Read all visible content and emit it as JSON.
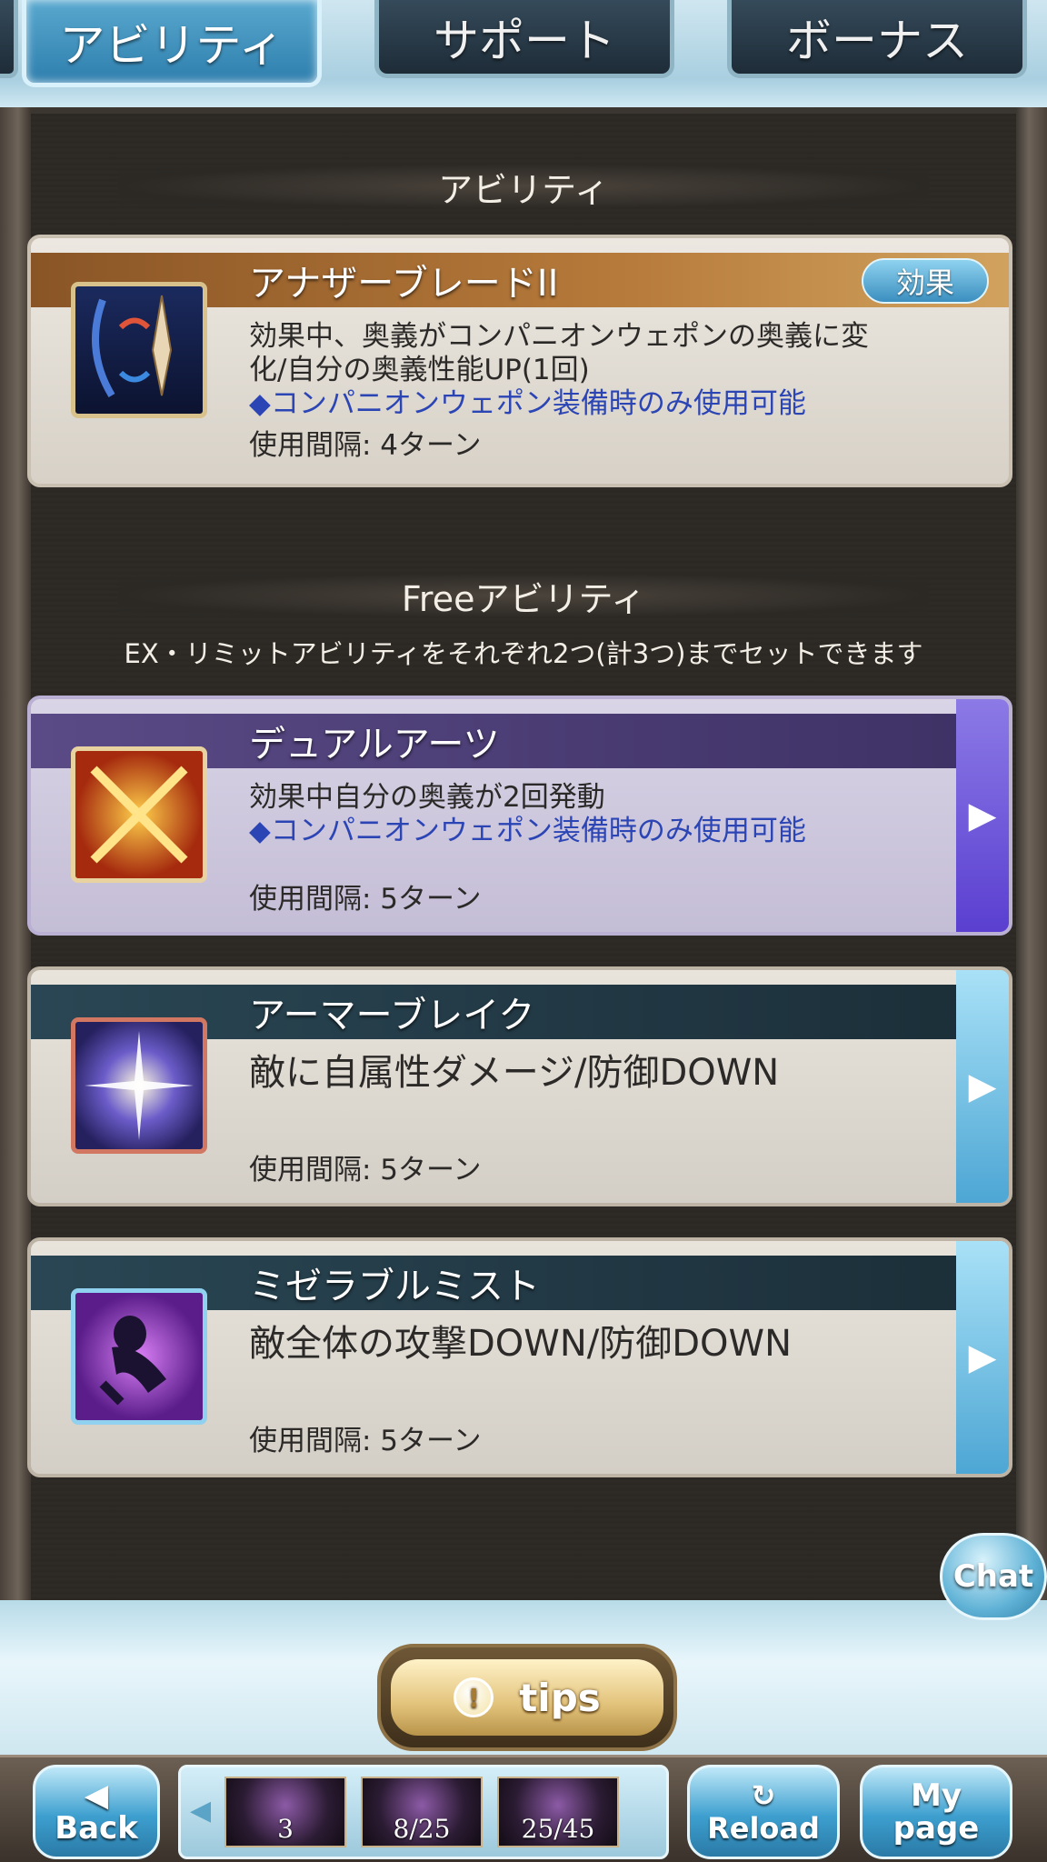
{
  "tabs": {
    "ability": "アビリティ",
    "support": "サポート",
    "bonus": "ボーナス"
  },
  "sections": {
    "ability_title": "アビリティ",
    "free_title": "Freeアビリティ",
    "free_note": "EX・リミットアビリティをそれぞれ2つ(計3つ)までセットできます"
  },
  "abilities": {
    "main": {
      "name": "アナザーブレードII",
      "effect_badge": "効果",
      "desc_line1": "効果中、奥義がコンパニオンウェポンの奥義に変",
      "desc_line2": "化/自分の奥義性能UP(1回)",
      "desc_note": "◆コンパニオンウェポン装備時のみ使用可能",
      "cooldown": "使用間隔: 4ターン"
    },
    "dual": {
      "name": "デュアルアーツ",
      "desc_line1": "効果中自分の奥義が2回発動",
      "desc_note": "◆コンパニオンウェポン装備時のみ使用可能",
      "cooldown": "使用間隔: 5ターン"
    },
    "armor": {
      "name": "アーマーブレイク",
      "desc_line1": "敵に自属性ダメージ/防御DOWN",
      "cooldown": "使用間隔: 5ターン"
    },
    "mist": {
      "name": "ミゼラブルミスト",
      "desc_line1": "敵全体の攻撃DOWN/防御DOWN",
      "cooldown": "使用間隔: 5ターン"
    }
  },
  "chat": {
    "label": "Chat"
  },
  "tips": {
    "label": "tips"
  },
  "nav": {
    "back_line1": "◀",
    "back_line2": "Back",
    "reload_line1": "↻",
    "reload_line2": "Reload",
    "mypage_line1": "My",
    "mypage_line2": "page",
    "quests": [
      "3",
      "8/25",
      "25/45"
    ]
  }
}
